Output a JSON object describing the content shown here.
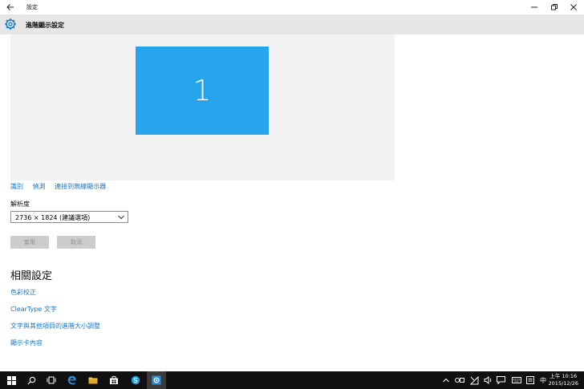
{
  "window": {
    "title": "設定",
    "back": "←"
  },
  "header": {
    "title": "進階顯示設定"
  },
  "preview": {
    "monitor_number": "1"
  },
  "links": {
    "identify": "識別",
    "detect": "偵測",
    "wireless": "連接到無線顯示器"
  },
  "resolution": {
    "label": "解析度",
    "value": "2736 × 1824 (建議選項)"
  },
  "buttons": {
    "apply": "套用",
    "cancel": "取消"
  },
  "related": {
    "title": "相關設定",
    "color_calibration": "色彩校正",
    "cleartype": "ClearType 文字",
    "advanced_sizing": "文字與其他項目的進階大小調整",
    "adapter_properties": "顯示卡內容"
  },
  "taskbar": {
    "icons": [
      "windows-start-icon",
      "search-icon",
      "task-view-icon",
      "edge-icon",
      "file-explorer-icon",
      "store-icon",
      "skype-icon",
      "settings-icon"
    ],
    "tray_icons": [
      "chevron-up-icon",
      "touch-keyboard-icon",
      "network-icon",
      "volume-icon",
      "keyboard-icon",
      "action-center-icon",
      "language-icon"
    ],
    "language": "中",
    "time": "上午 10:16",
    "date": "2015/12/26"
  },
  "colors": {
    "accent": "#1a78c2",
    "monitor": "#26a4ec",
    "header_bg": "#e6e6e6",
    "preview_bg": "#f2f2f2",
    "taskbar_bg": "#101010"
  }
}
